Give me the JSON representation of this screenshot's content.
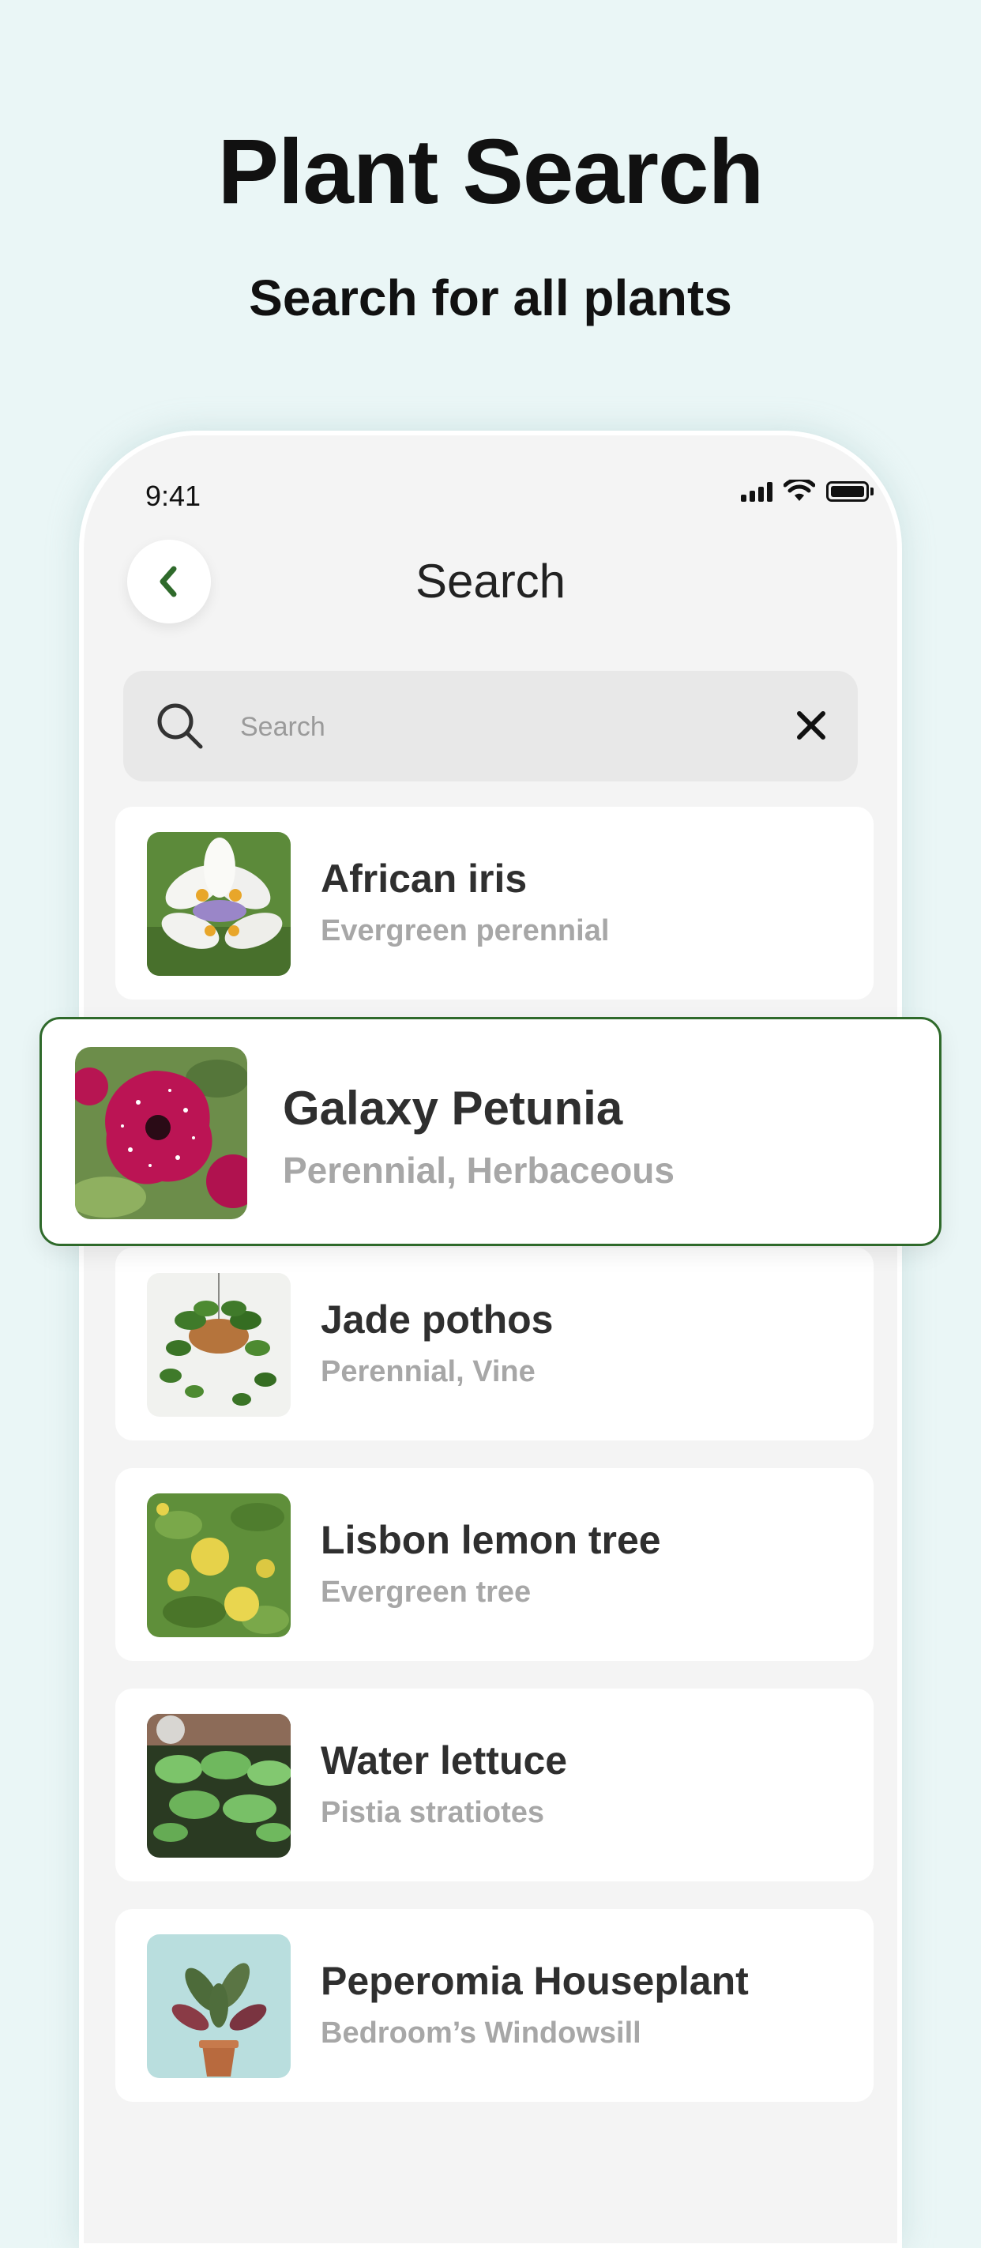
{
  "hero": {
    "title": "Plant Search",
    "subtitle": "Search for all plants"
  },
  "status_bar": {
    "time": "9:41",
    "icons": [
      "signal-icon",
      "wifi-icon",
      "battery-icon"
    ]
  },
  "nav": {
    "back_icon": "chevron-left-icon",
    "title": "Search"
  },
  "search": {
    "placeholder": "Search",
    "value": "",
    "icon": "search-icon",
    "clear_icon": "close-icon"
  },
  "colors": {
    "background": "#eaf6f6",
    "accent_green": "#2f6a2b",
    "card": "#ffffff",
    "subtitle_gray": "#a7a7a7"
  },
  "plants": [
    {
      "name": "African iris",
      "type": "Evergreen perennial"
    },
    {
      "name": "Galaxy Petunia",
      "type": "Perennial, Herbaceous",
      "highlighted": true
    },
    {
      "name": "Jade pothos",
      "type": "Perennial, Vine"
    },
    {
      "name": "Lisbon lemon tree",
      "type": "Evergreen tree"
    },
    {
      "name": "Water lettuce",
      "type": "Pistia stratiotes"
    },
    {
      "name": "Peperomia Houseplant",
      "type": "Bedroom’s Windowsill"
    }
  ]
}
